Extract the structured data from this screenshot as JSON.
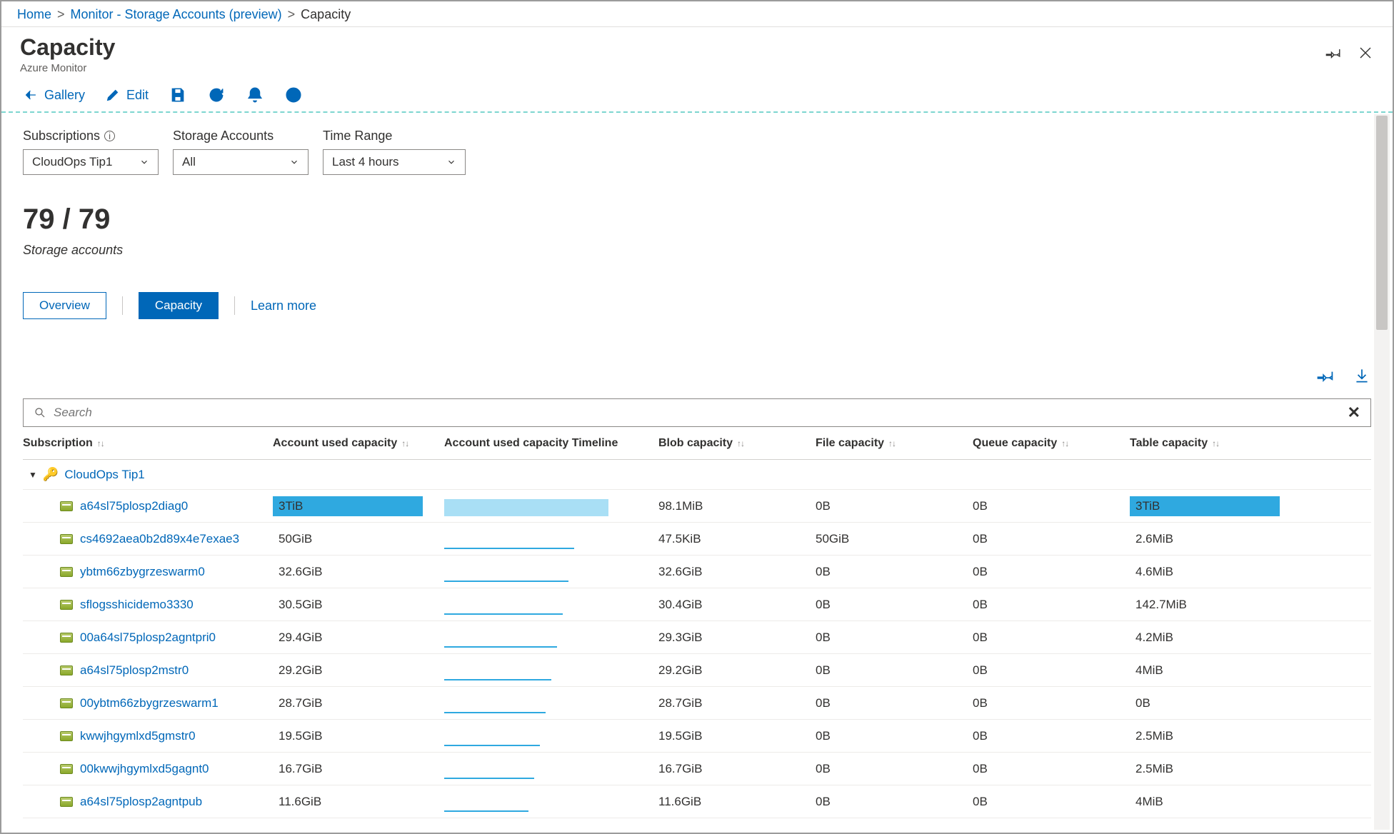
{
  "breadcrumb": {
    "home": "Home",
    "monitor": "Monitor - Storage Accounts (preview)",
    "current": "Capacity"
  },
  "header": {
    "title": "Capacity",
    "subtitle": "Azure Monitor"
  },
  "toolbar": {
    "gallery": "Gallery",
    "edit": "Edit"
  },
  "filters": {
    "subscriptions_label": "Subscriptions",
    "subscriptions_value": "CloudOps Tip1",
    "accounts_label": "Storage Accounts",
    "accounts_value": "All",
    "timerange_label": "Time Range",
    "timerange_value": "Last 4 hours"
  },
  "summary": {
    "count": "79 / 79",
    "label": "Storage accounts"
  },
  "tabs": {
    "overview": "Overview",
    "capacity": "Capacity",
    "learn": "Learn more"
  },
  "search": {
    "placeholder": "Search"
  },
  "columns": {
    "c1": "Subscription",
    "c2": "Account used capacity",
    "c3": "Account used capacity Timeline",
    "c4": "Blob capacity",
    "c5": "File capacity",
    "c6": "Queue capacity",
    "c7": "Table capacity"
  },
  "group": {
    "name": "CloudOps Tip1"
  },
  "rows": [
    {
      "name": "a64sl75plosp2diag0",
      "used": "3TiB",
      "usedBar": 210,
      "tl": "full",
      "blob": "98.1MiB",
      "file": "0B",
      "queue": "0B",
      "table": "3TiB",
      "tableBar": 210
    },
    {
      "name": "cs4692aea0b2d89x4e7exae3",
      "used": "50GiB",
      "usedBar": 0,
      "tl": "line",
      "blob": "47.5KiB",
      "file": "50GiB",
      "queue": "0B",
      "table": "2.6MiB",
      "tableBar": 0
    },
    {
      "name": "ybtm66zbygrzeswarm0",
      "used": "32.6GiB",
      "usedBar": 0,
      "tl": "line",
      "blob": "32.6GiB",
      "file": "0B",
      "queue": "0B",
      "table": "4.6MiB",
      "tableBar": 0
    },
    {
      "name": "sflogsshicidemo3330",
      "used": "30.5GiB",
      "usedBar": 0,
      "tl": "line",
      "blob": "30.4GiB",
      "file": "0B",
      "queue": "0B",
      "table": "142.7MiB",
      "tableBar": 0
    },
    {
      "name": "00a64sl75plosp2agntpri0",
      "used": "29.4GiB",
      "usedBar": 0,
      "tl": "line",
      "blob": "29.3GiB",
      "file": "0B",
      "queue": "0B",
      "table": "4.2MiB",
      "tableBar": 0
    },
    {
      "name": "a64sl75plosp2mstr0",
      "used": "29.2GiB",
      "usedBar": 0,
      "tl": "line",
      "blob": "29.2GiB",
      "file": "0B",
      "queue": "0B",
      "table": "4MiB",
      "tableBar": 0
    },
    {
      "name": "00ybtm66zbygrzeswarm1",
      "used": "28.7GiB",
      "usedBar": 0,
      "tl": "line",
      "blob": "28.7GiB",
      "file": "0B",
      "queue": "0B",
      "table": "0B",
      "tableBar": 0
    },
    {
      "name": "kwwjhgymlxd5gmstr0",
      "used": "19.5GiB",
      "usedBar": 0,
      "tl": "line",
      "blob": "19.5GiB",
      "file": "0B",
      "queue": "0B",
      "table": "2.5MiB",
      "tableBar": 0
    },
    {
      "name": "00kwwjhgymlxd5gagnt0",
      "used": "16.7GiB",
      "usedBar": 0,
      "tl": "line",
      "blob": "16.7GiB",
      "file": "0B",
      "queue": "0B",
      "table": "2.5MiB",
      "tableBar": 0
    },
    {
      "name": "a64sl75plosp2agntpub",
      "used": "11.6GiB",
      "usedBar": 0,
      "tl": "line",
      "blob": "11.6GiB",
      "file": "0B",
      "queue": "0B",
      "table": "4MiB",
      "tableBar": 0
    }
  ]
}
